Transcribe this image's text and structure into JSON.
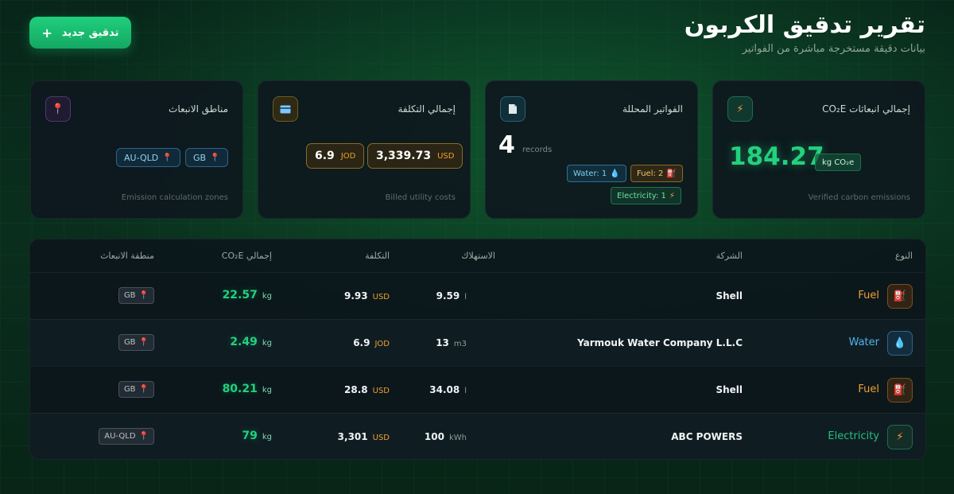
{
  "header": {
    "title": "تقرير تدقيق الكربون",
    "subtitle": "بيانات دقيقة مستخرجة مباشرة من الفواتير",
    "new_audit_label": "تدقيق جديد",
    "new_audit_icon": "plus-icon"
  },
  "cards": {
    "emissions": {
      "title": "إجمالي انبعاثات CO₂E",
      "icon": "bolt-icon",
      "value": "184.27",
      "unit": "kg CO₂e",
      "footer": "Verified carbon emissions"
    },
    "invoices": {
      "title": "الفواتير المحللة",
      "icon": "document-icon",
      "count": "4",
      "count_unit": "records",
      "chips": {
        "water": "Water: 1",
        "fuel": "Fuel: 2",
        "electricity": "Electricity: 1"
      }
    },
    "cost": {
      "title": "إجمالي التكلفة",
      "icon": "credit-card-icon",
      "amount_usd": "3,339.73",
      "currency_usd": "USD",
      "amount_jod": "6.9",
      "currency_jod": "JOD",
      "footer": "Billed utility costs"
    },
    "zones": {
      "title": "مناطق الانبعاث",
      "icon": "pin-icon",
      "zones": [
        "GB",
        "AU-QLD"
      ],
      "footer": "Emission calculation zones"
    }
  },
  "table": {
    "headers": {
      "type": "النوع",
      "company": "الشركة",
      "consumption": "الاستهلاك",
      "cost": "التكلفة",
      "co2": "إجمالي CO₂E",
      "zone": "منطقة الانبعاث"
    },
    "rows": [
      {
        "type": "Fuel",
        "company": "Shell",
        "consumption": "9.59",
        "cons_unit": "l",
        "cost": "9.93",
        "currency": "USD",
        "co2": "22.57",
        "co2_unit": "kg",
        "zone": "GB"
      },
      {
        "type": "Water",
        "company": "Yarmouk Water Company L.L.C",
        "consumption": "13",
        "cons_unit": "m3",
        "cost": "6.9",
        "currency": "JOD",
        "co2": "2.49",
        "co2_unit": "kg",
        "zone": "GB"
      },
      {
        "type": "Fuel",
        "company": "Shell",
        "consumption": "34.08",
        "cons_unit": "l",
        "cost": "28.8",
        "currency": "USD",
        "co2": "80.21",
        "co2_unit": "kg",
        "zone": "GB"
      },
      {
        "type": "Electricity",
        "company": "ABC POWERS",
        "consumption": "100",
        "cons_unit": "kWh",
        "cost": "3,301",
        "currency": "USD",
        "co2": "79",
        "co2_unit": "kg",
        "zone": "AU-QLD"
      }
    ]
  },
  "colors": {
    "accent": "#23d07e",
    "amber": "#f0a030",
    "water": "#4fb5ea",
    "pin": "#ff4e7c"
  }
}
